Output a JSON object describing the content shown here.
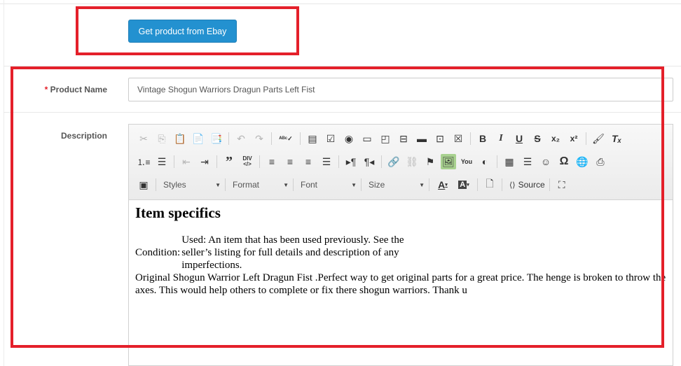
{
  "ebay_button": {
    "label": "Get product from Ebay"
  },
  "product_name": {
    "required_mark": "*",
    "label": "Product Name",
    "value": "Vintage Shogun Warriors Dragun Parts Left Fist"
  },
  "description": {
    "label": "Description",
    "toolbar": {
      "styles": "Styles",
      "format": "Format",
      "font": "Font",
      "size": "Size",
      "source": "Source"
    },
    "content": {
      "heading": "Item specifics",
      "spec_key": "Condition:",
      "spec_value": "Used: An item that has been used previously. See the seller’s listing for full details and description of any imperfections.",
      "body": "Original Shogun Warrior Left Dragun Fist .Perfect way to get original parts for a great price. The henge is broken to throw the axes. This would help others to complete or fix there shogun warriors. Thank u"
    }
  },
  "colors": {
    "accent": "#2391d0",
    "highlight_box": "#e4202a",
    "required": "#e4202a"
  }
}
